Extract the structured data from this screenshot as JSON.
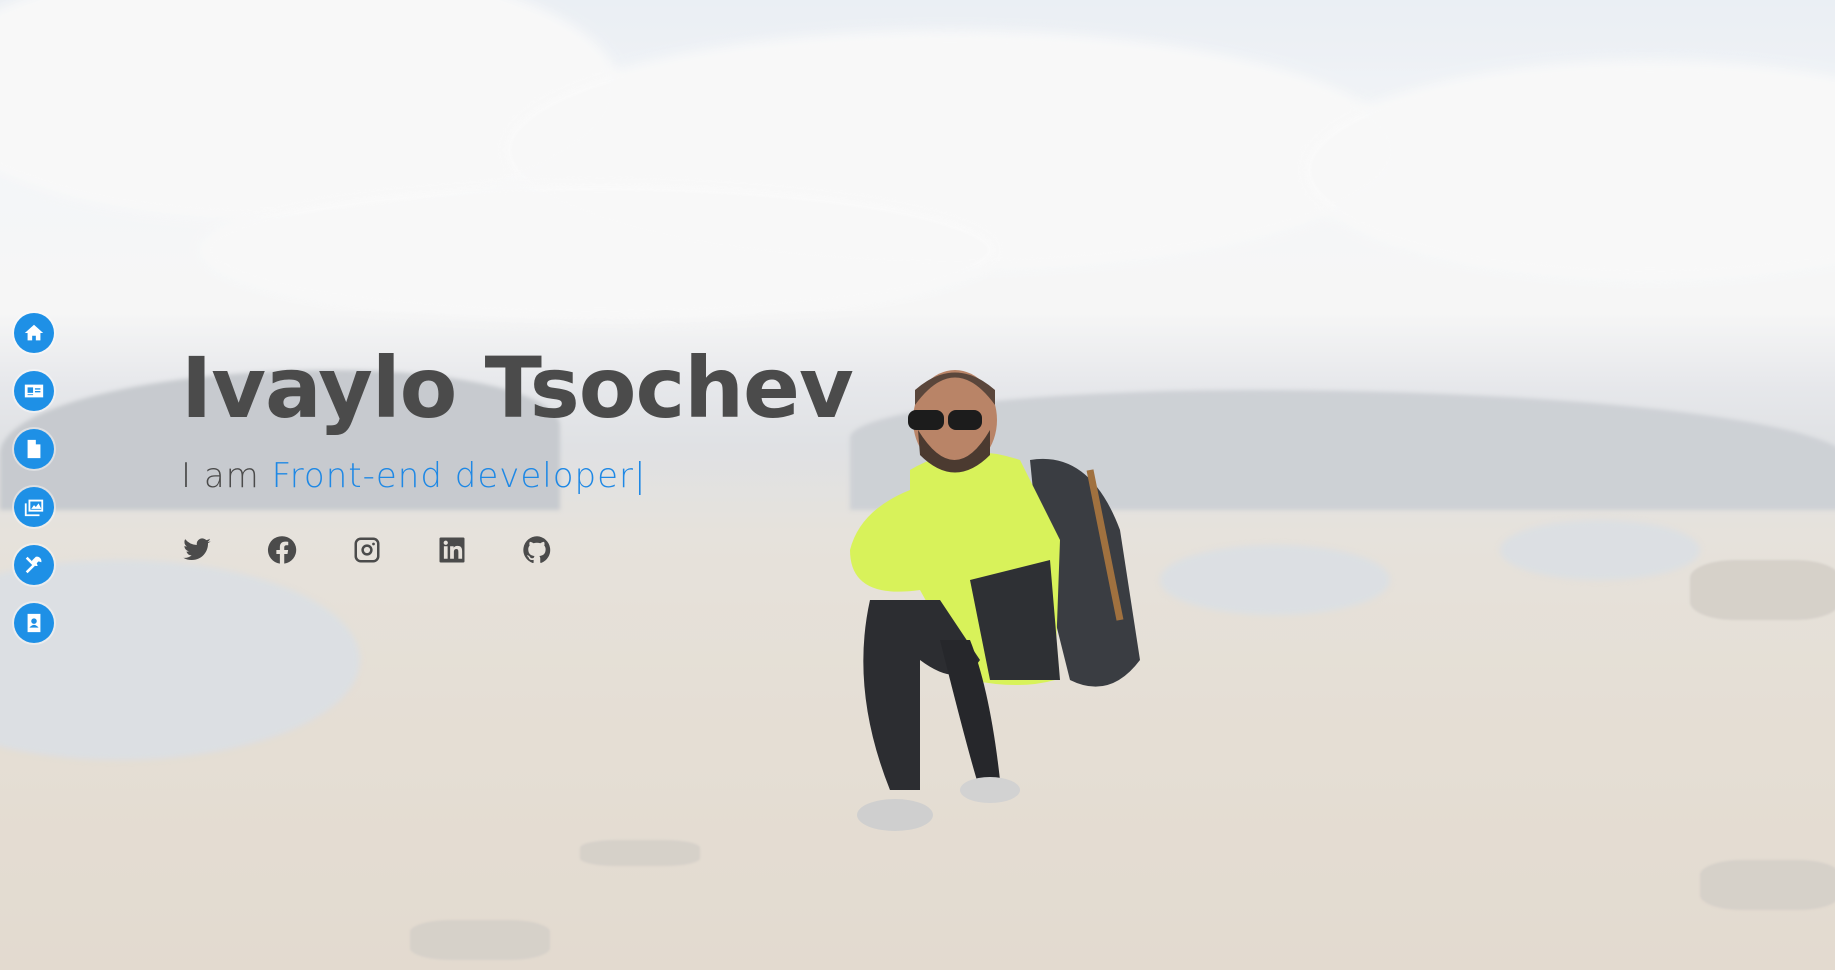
{
  "hero": {
    "name": "Ivaylo Tsochev",
    "intro": "I am",
    "role": "Front-end developer",
    "caret": "|"
  },
  "side_nav": {
    "items": [
      {
        "name": "home",
        "icon": "home-icon"
      },
      {
        "name": "about",
        "icon": "id-card-icon"
      },
      {
        "name": "resume",
        "icon": "file-icon"
      },
      {
        "name": "portfolio",
        "icon": "images-icon"
      },
      {
        "name": "services",
        "icon": "tools-icon"
      },
      {
        "name": "contact",
        "icon": "address-book-icon"
      }
    ]
  },
  "social": {
    "items": [
      "twitter-icon",
      "facebook-icon",
      "instagram-icon",
      "linkedin-icon",
      "github-icon"
    ]
  },
  "colors": {
    "accent": "#1e88e5",
    "nav_button": "#1e90e6",
    "text": "#4b4b4b",
    "jacket": "#d8f25a"
  }
}
